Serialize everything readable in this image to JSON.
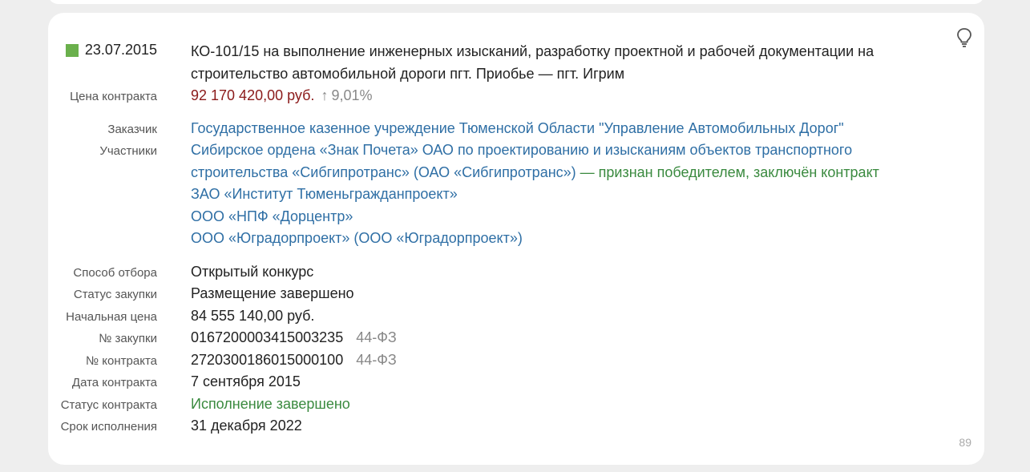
{
  "record": {
    "date": "23.07.2015",
    "title_line1": "КО-101/15 на выполнение инженерных изысканий, разработку проектной и рабочей документации на",
    "title_line2": "строительство автомобильной дороги пгт. Приобье — пгт. Игрим",
    "status_color": "#6ab04c"
  },
  "contract_price": {
    "label": "Цена контракта",
    "value": "92 170 420,00 руб.",
    "arrow": "↑",
    "change": "9,01%"
  },
  "customer": {
    "label": "Заказчик",
    "value": "Государственное казенное учреждение Тюменской Области \"Управление Автомобильных Дорог\""
  },
  "participants": {
    "label": "Участники",
    "items": [
      {
        "line1": "Сибирское ордена «Знак Почета» ОАО по проектированию и изысканиям объектов транспортного",
        "line2": "строительства «Сибгипротранс» (ОАО «Сибгипротранс»)",
        "note": " — признан победителем, заключён контракт"
      },
      {
        "name": "ЗАО «Институт Тюменьгражданпроект»"
      },
      {
        "name": "ООО «НПФ «Дорцентр»"
      },
      {
        "name": "ООО «Юградорпроект» (ООО «Юградорпроект»)"
      }
    ]
  },
  "details": [
    {
      "label": "Способ отбора",
      "value": "Открытый конкурс"
    },
    {
      "label": "Статус закупки",
      "value": "Размещение завершено"
    },
    {
      "label": "Начальная цена",
      "value": "84 555 140,00 руб."
    },
    {
      "label": "№ закупки",
      "value": "0167200003415003235",
      "law": "44-ФЗ"
    },
    {
      "label": "№ контракта",
      "value": "2720300186015000100",
      "law": "44-ФЗ"
    },
    {
      "label": "Дата контракта",
      "value": "7 сентября 2015"
    },
    {
      "label": "Статус контракта",
      "value": "Исполнение завершено"
    },
    {
      "label": "Срок исполнения",
      "value": "31 декабря 2022"
    }
  ],
  "page_number": "89",
  "icons": {
    "hint": "lightbulb-icon"
  },
  "colors": {
    "link": "#2f6fa5",
    "price": "#8b1a1a",
    "success": "#3a8a3f",
    "muted": "#888888"
  }
}
